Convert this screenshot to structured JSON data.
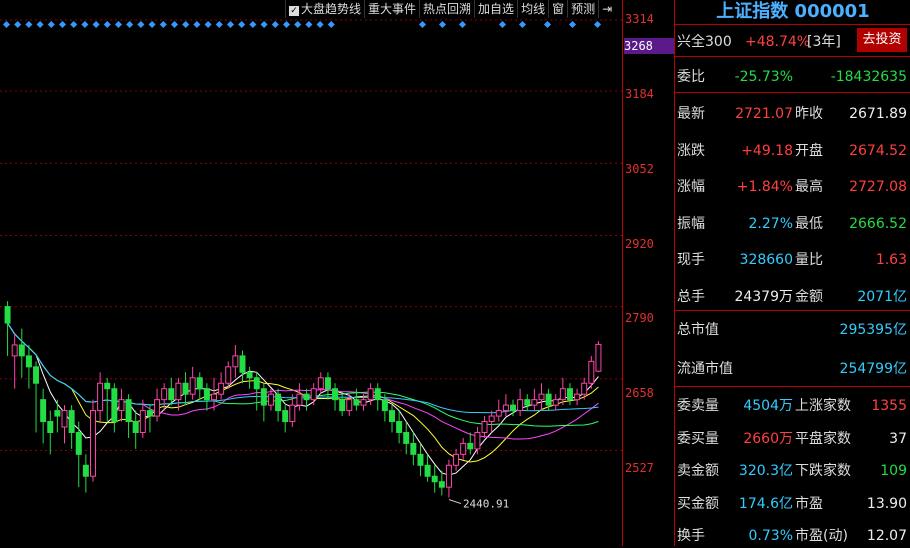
{
  "toolbar": {
    "items": [
      "大盘趋势线",
      "重大事件",
      "热点回溯",
      "加自选",
      "均线",
      "窗",
      "预测"
    ]
  },
  "yaxis": {
    "ticks": [
      "3314",
      "3184",
      "3052",
      "2920",
      "2790",
      "2658",
      "2527"
    ],
    "current_price": "3268"
  },
  "chart_data": {
    "type": "candlestick",
    "ylim": [
      2400,
      3314
    ],
    "low_annotation": "2440.91",
    "candles": [
      [
        2790,
        2760,
        2700,
        2800
      ],
      [
        2700,
        2720,
        2640,
        2740
      ],
      [
        2720,
        2700,
        2660,
        2750
      ],
      [
        2700,
        2680,
        2640,
        2720
      ],
      [
        2680,
        2650,
        2560,
        2690
      ],
      [
        2620,
        2580,
        2540,
        2640
      ],
      [
        2580,
        2560,
        2520,
        2600
      ],
      [
        2600,
        2590,
        2560,
        2620
      ],
      [
        2570,
        2600,
        2540,
        2610
      ],
      [
        2600,
        2560,
        2530,
        2610
      ],
      [
        2560,
        2520,
        2460,
        2580
      ],
      [
        2500,
        2480,
        2450,
        2520
      ],
      [
        2480,
        2600,
        2470,
        2620
      ],
      [
        2600,
        2650,
        2580,
        2670
      ],
      [
        2650,
        2640,
        2580,
        2660
      ],
      [
        2640,
        2580,
        2560,
        2650
      ],
      [
        2600,
        2620,
        2580,
        2640
      ],
      [
        2620,
        2580,
        2550,
        2630
      ],
      [
        2580,
        2560,
        2530,
        2600
      ],
      [
        2560,
        2600,
        2550,
        2620
      ],
      [
        2600,
        2590,
        2560,
        2610
      ],
      [
        2590,
        2620,
        2580,
        2640
      ],
      [
        2620,
        2640,
        2600,
        2650
      ],
      [
        2640,
        2620,
        2610,
        2660
      ],
      [
        2620,
        2650,
        2600,
        2660
      ],
      [
        2650,
        2630,
        2610,
        2670
      ],
      [
        2630,
        2660,
        2620,
        2680
      ],
      [
        2660,
        2640,
        2620,
        2670
      ],
      [
        2640,
        2620,
        2600,
        2650
      ],
      [
        2620,
        2630,
        2600,
        2660
      ],
      [
        2630,
        2650,
        2620,
        2670
      ],
      [
        2650,
        2680,
        2640,
        2690
      ],
      [
        2680,
        2700,
        2660,
        2720
      ],
      [
        2700,
        2670,
        2650,
        2710
      ],
      [
        2670,
        2660,
        2640,
        2680
      ],
      [
        2660,
        2640,
        2600,
        2670
      ],
      [
        2640,
        2610,
        2580,
        2650
      ],
      [
        2610,
        2630,
        2600,
        2640
      ],
      [
        2630,
        2600,
        2580,
        2640
      ],
      [
        2600,
        2580,
        2560,
        2610
      ],
      [
        2580,
        2610,
        2570,
        2630
      ],
      [
        2610,
        2630,
        2600,
        2650
      ],
      [
        2630,
        2620,
        2600,
        2640
      ],
      [
        2620,
        2640,
        2610,
        2650
      ],
      [
        2640,
        2660,
        2630,
        2670
      ],
      [
        2660,
        2640,
        2620,
        2670
      ],
      [
        2640,
        2620,
        2600,
        2650
      ],
      [
        2620,
        2600,
        2590,
        2630
      ],
      [
        2600,
        2620,
        2590,
        2630
      ],
      [
        2620,
        2610,
        2600,
        2640
      ],
      [
        2610,
        2620,
        2600,
        2630
      ],
      [
        2620,
        2640,
        2610,
        2650
      ],
      [
        2640,
        2620,
        2600,
        2650
      ],
      [
        2620,
        2600,
        2580,
        2630
      ],
      [
        2600,
        2580,
        2560,
        2610
      ],
      [
        2580,
        2560,
        2540,
        2600
      ],
      [
        2560,
        2540,
        2520,
        2580
      ],
      [
        2540,
        2520,
        2500,
        2560
      ],
      [
        2520,
        2500,
        2480,
        2540
      ],
      [
        2500,
        2480,
        2470,
        2520
      ],
      [
        2480,
        2470,
        2450,
        2500
      ],
      [
        2470,
        2460,
        2445,
        2490
      ],
      [
        2460,
        2500,
        2441,
        2510
      ],
      [
        2500,
        2520,
        2490,
        2530
      ],
      [
        2520,
        2540,
        2510,
        2550
      ],
      [
        2540,
        2530,
        2520,
        2560
      ],
      [
        2530,
        2560,
        2520,
        2570
      ],
      [
        2560,
        2580,
        2550,
        2590
      ],
      [
        2580,
        2590,
        2560,
        2600
      ],
      [
        2590,
        2600,
        2580,
        2620
      ],
      [
        2600,
        2610,
        2590,
        2630
      ],
      [
        2610,
        2600,
        2590,
        2620
      ],
      [
        2600,
        2620,
        2590,
        2640
      ],
      [
        2620,
        2610,
        2600,
        2630
      ],
      [
        2610,
        2620,
        2600,
        2640
      ],
      [
        2620,
        2630,
        2600,
        2650
      ],
      [
        2630,
        2610,
        2600,
        2640
      ],
      [
        2610,
        2620,
        2600,
        2630
      ],
      [
        2620,
        2640,
        2610,
        2660
      ],
      [
        2640,
        2620,
        2610,
        2650
      ],
      [
        2620,
        2630,
        2610,
        2640
      ],
      [
        2630,
        2650,
        2620,
        2660
      ],
      [
        2650,
        2690,
        2640,
        2700
      ],
      [
        2672,
        2721,
        2670,
        2727
      ]
    ]
  },
  "panel": {
    "title": "上证指数 000001",
    "compare_label": "兴全300",
    "compare_value": "+48.74%",
    "compare_period": "[3年]",
    "invest_button": "去投资",
    "weibi_label": "委比",
    "weibi_pct": "-25.73%",
    "weibi_val": "-18432635",
    "rows": [
      {
        "l1": "最新",
        "v1": "2721.07",
        "c1": "red",
        "l2": "昨收",
        "v2": "2671.89",
        "c2": "white"
      },
      {
        "l1": "涨跌",
        "v1": "+49.18",
        "c1": "red",
        "l2": "开盘",
        "v2": "2674.52",
        "c2": "red"
      },
      {
        "l1": "涨幅",
        "v1": "+1.84%",
        "c1": "red",
        "l2": "最高",
        "v2": "2727.08",
        "c2": "red"
      },
      {
        "l1": "振幅",
        "v1": "2.27%",
        "c1": "cyan",
        "l2": "最低",
        "v2": "2666.52",
        "c2": "green"
      },
      {
        "l1": "现手",
        "v1": "328660",
        "c1": "cyan",
        "l2": "量比",
        "v2": "1.63",
        "c2": "red"
      },
      {
        "l1": "总手",
        "v1": "24379万",
        "c1": "white",
        "l2": "金额",
        "v2": "2071亿",
        "c2": "cyan"
      }
    ],
    "total_mv_label": "总市值",
    "total_mv": "295395亿",
    "float_mv_label": "流通市值",
    "float_mv": "254799亿",
    "rows2": [
      {
        "l1": "委卖量",
        "v1": "4504万",
        "c1": "cyan",
        "l2": "上涨家数",
        "v2": "1355",
        "c2": "red"
      },
      {
        "l1": "委买量",
        "v1": "2660万",
        "c1": "red",
        "l2": "平盘家数",
        "v2": "37",
        "c2": "white"
      },
      {
        "l1": "卖金额",
        "v1": "320.3亿",
        "c1": "cyan",
        "l2": "下跌家数",
        "v2": "109",
        "c2": "green"
      },
      {
        "l1": "买金额",
        "v1": "174.6亿",
        "c1": "cyan",
        "l2": "市盈",
        "v2": "13.90",
        "c2": "white"
      },
      {
        "l1": "换手",
        "v1": "0.73%",
        "c1": "cyan",
        "l2": "市盈(动)",
        "v2": "12.07",
        "c2": "white"
      }
    ],
    "colors": {
      "up": "#ff4040",
      "down": "#22dd44",
      "accent": "#33ccff",
      "grid": "#b00000"
    }
  }
}
